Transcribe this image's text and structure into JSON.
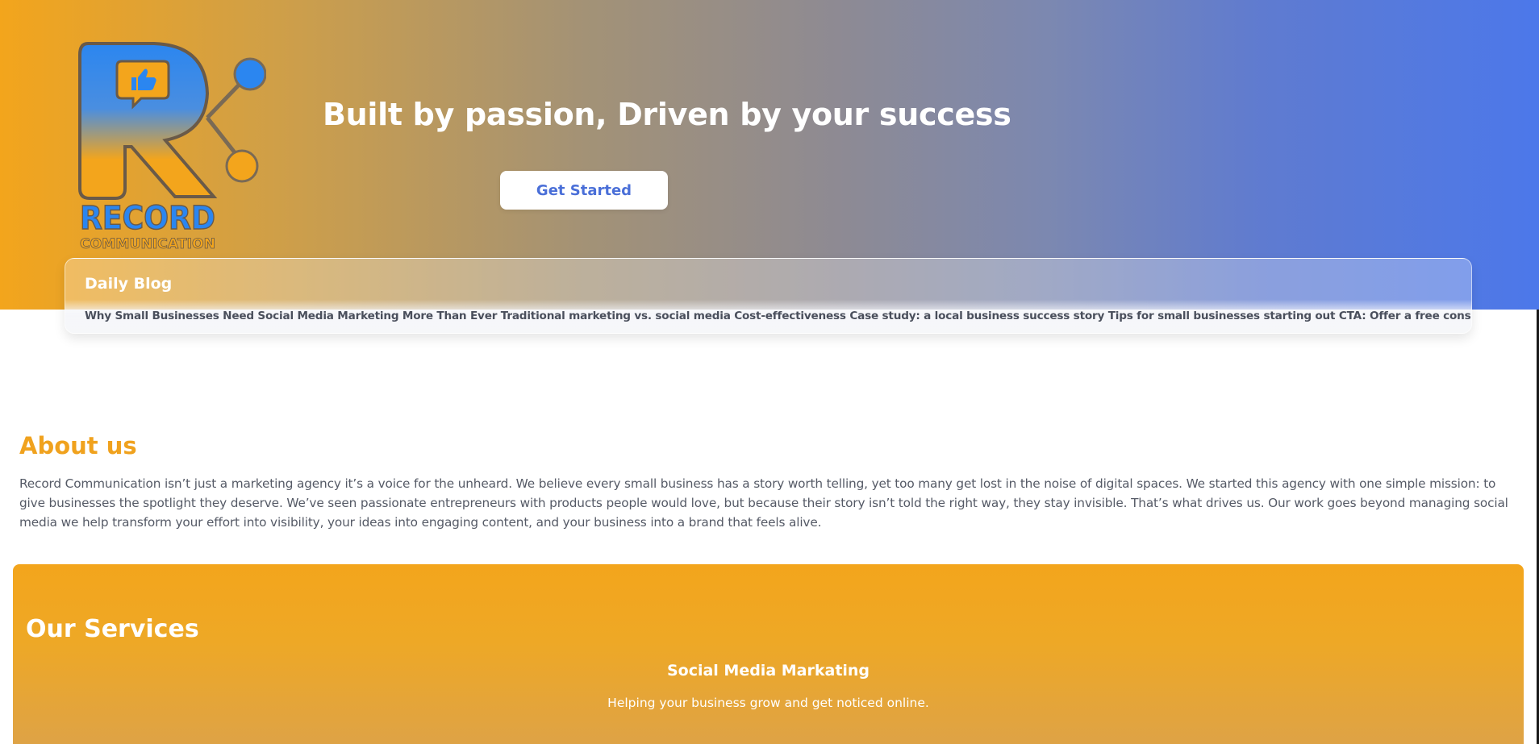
{
  "brand": {
    "logo_line1": "RECORD",
    "logo_line2": "COMMUNICATION",
    "colors": {
      "orange": "#f3a51c",
      "blue": "#4c78ea",
      "logo_blue": "#2b86f0"
    }
  },
  "hero": {
    "title": "Built by passion, Driven by your success",
    "cta_label": "Get Started"
  },
  "blog": {
    "title": "Daily Blog",
    "text": "Why Small Businesses Need Social Media Marketing More Than Ever Traditional marketing vs. social media Cost-effectiveness Case study: a local business success story Tips for small businesses starting out CTA: Offer a free consultation"
  },
  "about": {
    "title": "About us",
    "text": "Record Communication isn’t just a marketing agency it’s a voice for the unheard. We believe every small business has a story worth telling, yet too many get lost in the noise of digital spaces. We started this agency with one simple mission: to give businesses the spotlight they deserve. We’ve seen passionate entrepreneurs with products people would love, but because their story isn’t told the right way, they stay invisible. That’s what drives us. Our work goes beyond managing social media we help transform your effort into visibility, your ideas into engaging content, and your business into a brand that feels alive."
  },
  "services": {
    "title": "Our Services",
    "items": [
      {
        "name": "Social Media Markating",
        "description": "Helping your business grow and get noticed online."
      }
    ]
  },
  "icons": {
    "logo_badge": "thumbs-up-chat-icon",
    "logo_network": "network-nodes-icon"
  }
}
